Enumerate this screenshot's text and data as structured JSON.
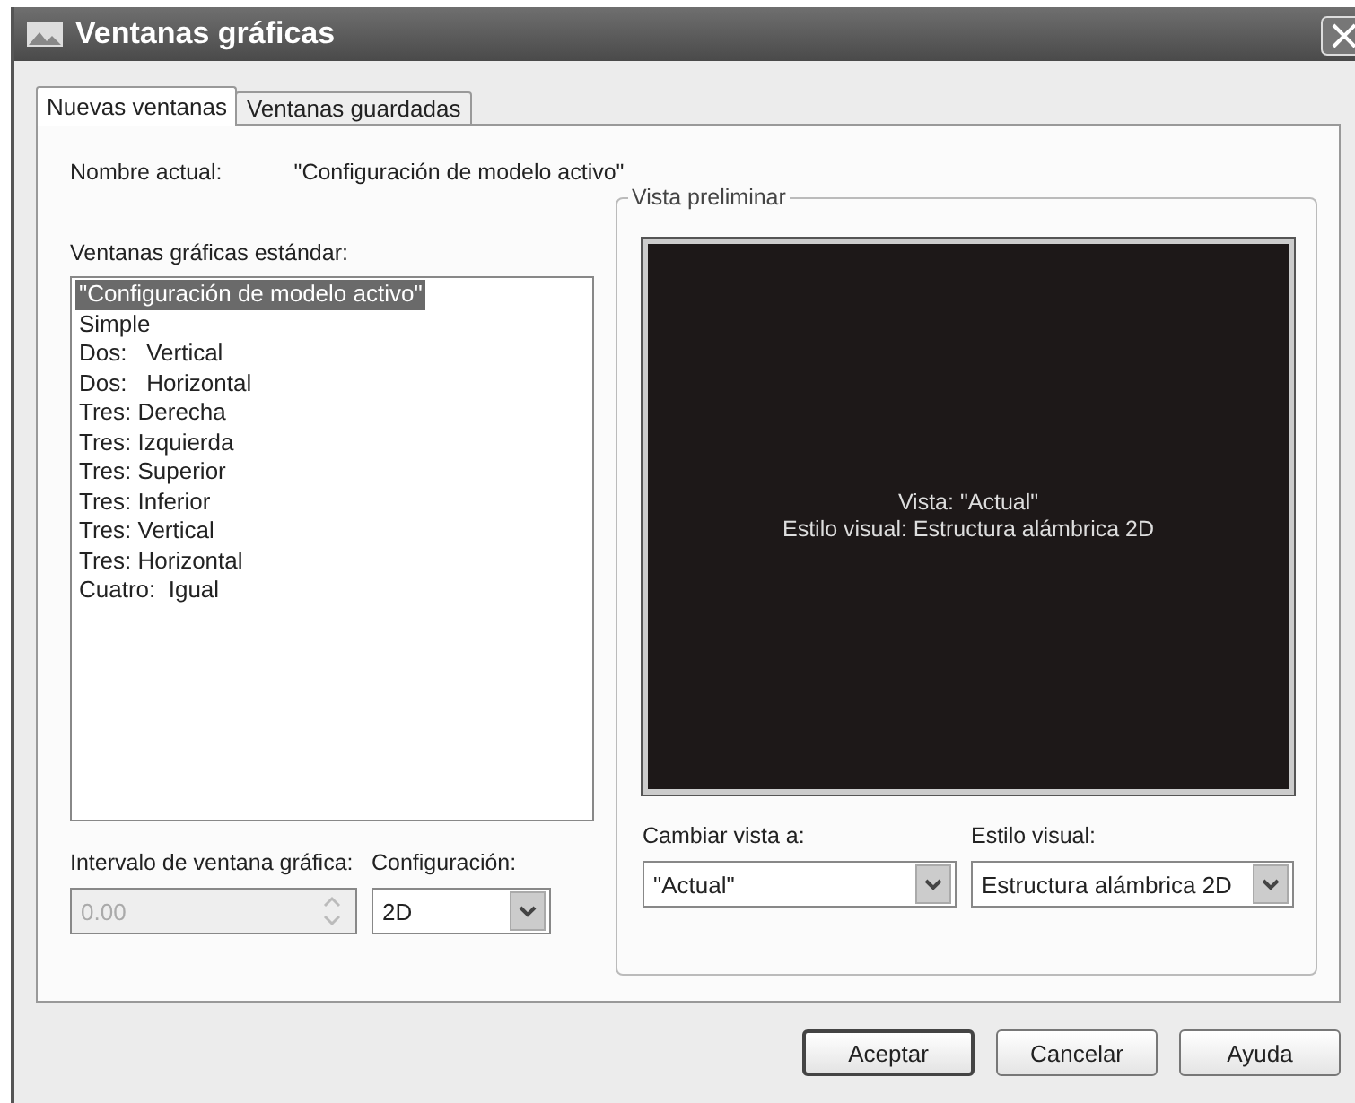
{
  "window": {
    "title": "Ventanas gráficas"
  },
  "tabs": [
    {
      "label": "Nuevas ventanas",
      "selected": true
    },
    {
      "label": "Ventanas guardadas",
      "selected": false
    }
  ],
  "current_name": {
    "label": "Nombre actual:",
    "value": "\"Configuración de modelo activo\""
  },
  "standard_viewports": {
    "label": "Ventanas gráficas estándar:",
    "items": [
      {
        "label": "\"Configuración de modelo activo\"",
        "selected": true
      },
      {
        "label": "Simple",
        "selected": false
      },
      {
        "label": "Dos:   Vertical",
        "selected": false
      },
      {
        "label": "Dos:   Horizontal",
        "selected": false
      },
      {
        "label": "Tres: Derecha",
        "selected": false
      },
      {
        "label": "Tres: Izquierda",
        "selected": false
      },
      {
        "label": "Tres: Superior",
        "selected": false
      },
      {
        "label": "Tres: Inferior",
        "selected": false
      },
      {
        "label": "Tres: Vertical",
        "selected": false
      },
      {
        "label": "Tres: Horizontal",
        "selected": false
      },
      {
        "label": "Cuatro:  Igual",
        "selected": false
      }
    ]
  },
  "spacing": {
    "label": "Intervalo de ventana gráfica:",
    "value": "0.00",
    "disabled": true
  },
  "setup": {
    "label": "Configuración:",
    "value": "2D"
  },
  "preview": {
    "legend": "Vista preliminar",
    "lines": [
      "Vista: \"Actual\"",
      "Estilo visual: Estructura alámbrica 2D"
    ]
  },
  "change_view": {
    "label": "Cambiar vista a:",
    "value": "\"Actual\""
  },
  "visual_style": {
    "label": "Estilo visual:",
    "value": "Estructura alámbrica 2D"
  },
  "buttons": [
    {
      "label": "Aceptar",
      "default": true
    },
    {
      "label": "Cancelar",
      "default": false
    },
    {
      "label": "Ayuda",
      "default": false
    }
  ]
}
